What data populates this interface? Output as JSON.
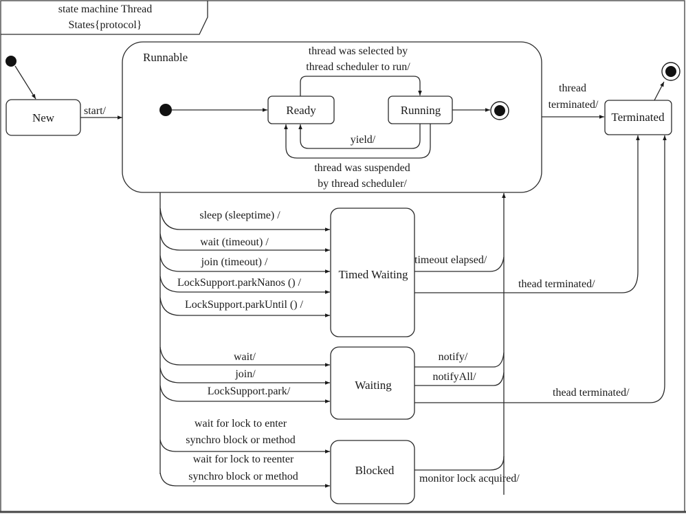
{
  "frame": {
    "title_line1": "state machine Thread",
    "title_line2": "States{protocol}"
  },
  "states": {
    "new": "New",
    "runnable": "Runnable",
    "ready": "Ready",
    "running": "Running",
    "terminated": "Terminated",
    "timed_waiting": "Timed Waiting",
    "waiting": "Waiting",
    "blocked": "Blocked"
  },
  "transitions": {
    "start": "start/",
    "selected_line1": "thread was selected by",
    "selected_line2": "thread scheduler to run/",
    "yield": "yield/",
    "suspended_line1": "thread was suspended",
    "suspended_line2": "by thread scheduler/",
    "thread_terminated_line1": "thread",
    "thread_terminated_line2": "terminated/",
    "sleep": "sleep (sleeptime) /",
    "wait_timeout": "wait (timeout) /",
    "join_timeout": "join (timeout) /",
    "park_nanos": "LockSupport.parkNanos () /",
    "park_until": "LockSupport.parkUntil () /",
    "timeout_elapsed": "timeout elapsed/",
    "timed_thead_terminated": "thead terminated/",
    "wait": "wait/",
    "join": "join/",
    "park": "LockSupport.park/",
    "notify": "notify/",
    "notify_all": "notifyAll/",
    "waiting_thead_terminated": "thead terminated/",
    "lock_enter_line1": "wait for lock to enter",
    "lock_enter_line2": "synchro block or method",
    "lock_reenter_line1": "wait for lock to reenter",
    "lock_reenter_line2": "synchro block or method",
    "monitor_acquired": "monitor lock acquired/"
  }
}
